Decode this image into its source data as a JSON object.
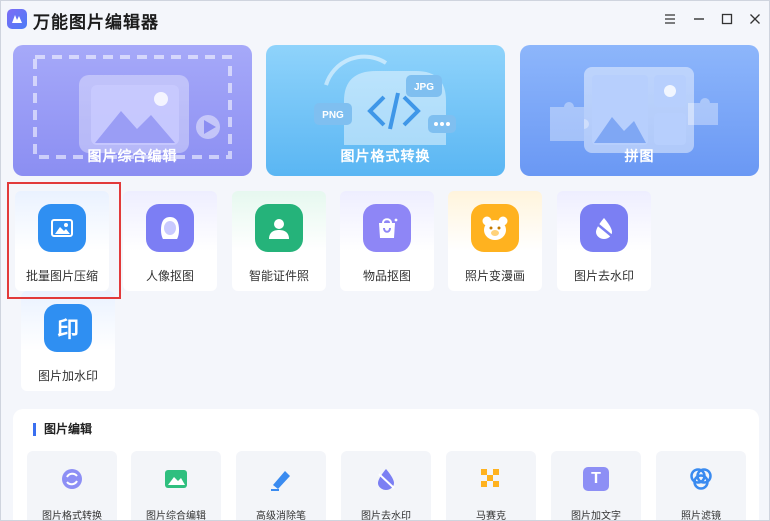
{
  "app": {
    "title": "万能图片编辑器"
  },
  "feature_cards": [
    {
      "label": "图片综合编辑",
      "art_badges": []
    },
    {
      "label": "图片格式转换",
      "art_badges": [
        "PNG",
        "JPG"
      ]
    },
    {
      "label": "拼图",
      "art_badges": []
    }
  ],
  "tools": [
    {
      "label": "批量图片压缩",
      "icon": "image-compress-icon",
      "color": "#2f8ff2"
    },
    {
      "label": "人像抠图",
      "icon": "portrait-cutout-icon",
      "color": "#7c7ef4"
    },
    {
      "label": "智能证件照",
      "icon": "id-photo-icon",
      "color": "#25b37a"
    },
    {
      "label": "物品抠图",
      "icon": "object-cutout-icon",
      "color": "#8e86f6"
    },
    {
      "label": "照片变漫画",
      "icon": "cartoon-bear-icon",
      "color": "#ffb21f"
    },
    {
      "label": "图片去水印",
      "icon": "watermark-remove-icon",
      "color": "#7b7ff3"
    },
    {
      "label": "图片加水印",
      "icon": "watermark-add-icon",
      "color": "#2f8ff2"
    }
  ],
  "tool_icon_text": {
    "watermark_add": "印"
  },
  "edit_section": {
    "title": "图片编辑",
    "items": [
      {
        "label": "图片格式转换",
        "icon": "format-convert-icon"
      },
      {
        "label": "图片综合编辑",
        "icon": "comprehensive-edit-icon"
      },
      {
        "label": "高级消除笔",
        "icon": "eraser-pen-icon"
      },
      {
        "label": "图片去水印",
        "icon": "drop-remove-icon"
      },
      {
        "label": "马赛克",
        "icon": "mosaic-icon"
      },
      {
        "label": "图片加文字",
        "icon": "add-text-icon"
      },
      {
        "label": "照片滤镜",
        "icon": "photo-filter-icon"
      }
    ],
    "text_icon_glyph": "T"
  },
  "colors": {
    "accent": "#3a6ff0",
    "highlight": "#e23a3a"
  }
}
